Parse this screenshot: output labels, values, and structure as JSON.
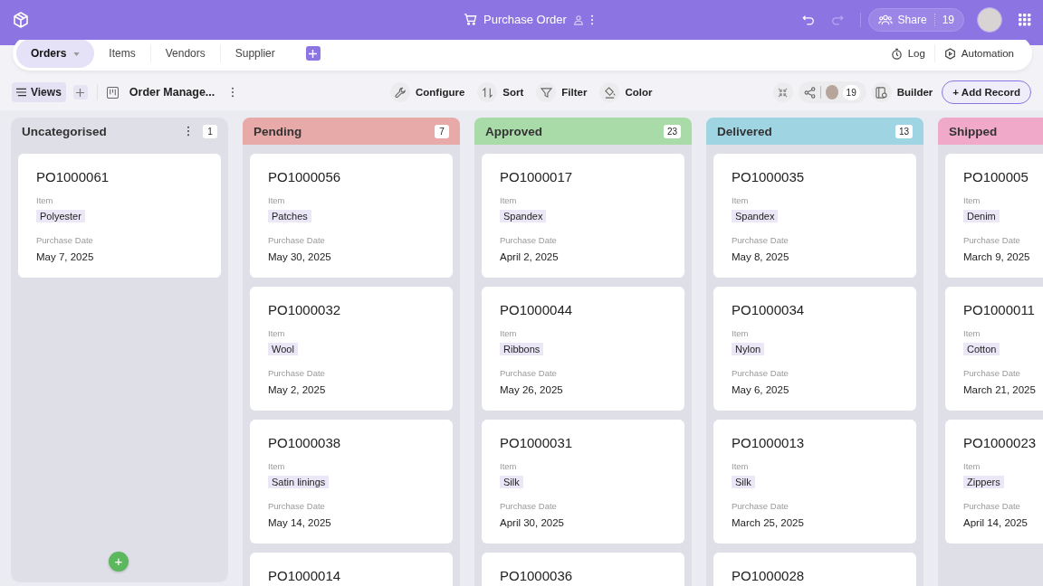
{
  "header": {
    "title": "Purchase Order",
    "share": {
      "label": "Share",
      "count": "19"
    }
  },
  "tabs": [
    {
      "label": "Orders",
      "selected": true
    },
    {
      "label": "Items",
      "selected": false
    },
    {
      "label": "Vendors",
      "selected": false
    },
    {
      "label": "Supplier",
      "selected": false
    }
  ],
  "tab_actions": [
    {
      "kind": "log",
      "label": "Log"
    },
    {
      "kind": "automation",
      "label": "Automation"
    }
  ],
  "toolbar": {
    "views": "Views",
    "view_name": "Order Manage...",
    "tools": [
      {
        "kind": "configure",
        "label": "Configure"
      },
      {
        "kind": "sort",
        "label": "Sort"
      },
      {
        "kind": "filter",
        "label": "Filter"
      },
      {
        "kind": "color",
        "label": "Color"
      }
    ],
    "collaborators": "19",
    "builder": "Builder",
    "add_record": "+ Add Record"
  },
  "columns": [
    {
      "kind": "uncategorised",
      "title": "Uncategorised",
      "count": "1",
      "add": "+",
      "cards": [
        {
          "id": "PO1000061",
          "item_label": "Item",
          "item": "Polyester",
          "date_label": "Purchase Date",
          "date": "May 7, 2025"
        }
      ]
    },
    {
      "kind": "status",
      "title": "Pending",
      "color": "#e8aaa8",
      "count": "7",
      "cards": [
        {
          "id": "PO1000056",
          "item_label": "Item",
          "item": "Patches",
          "date_label": "Purchase Date",
          "date": "May 30, 2025"
        },
        {
          "id": "PO1000032",
          "item_label": "Item",
          "item": "Wool",
          "date_label": "Purchase Date",
          "date": "May 2, 2025"
        },
        {
          "id": "PO1000038",
          "item_label": "Item",
          "item": "Satin linings",
          "date_label": "Purchase Date",
          "date": "May 14, 2025"
        },
        {
          "id": "PO1000014"
        }
      ]
    },
    {
      "kind": "status",
      "title": "Approved",
      "color": "#a9dba9",
      "count": "23",
      "cards": [
        {
          "id": "PO1000017",
          "item_label": "Item",
          "item": "Spandex",
          "date_label": "Purchase Date",
          "date": "April 2, 2025"
        },
        {
          "id": "PO1000044",
          "item_label": "Item",
          "item": "Ribbons",
          "date_label": "Purchase Date",
          "date": "May 26, 2025"
        },
        {
          "id": "PO1000031",
          "item_label": "Item",
          "item": "Silk",
          "date_label": "Purchase Date",
          "date": "April 30, 2025"
        },
        {
          "id": "PO1000036"
        }
      ]
    },
    {
      "kind": "status",
      "title": "Delivered",
      "color": "#9fd5e3",
      "count": "13",
      "cards": [
        {
          "id": "PO1000035",
          "item_label": "Item",
          "item": "Spandex",
          "date_label": "Purchase Date",
          "date": "May 8, 2025"
        },
        {
          "id": "PO1000034",
          "item_label": "Item",
          "item": "Nylon",
          "date_label": "Purchase Date",
          "date": "May 6, 2025"
        },
        {
          "id": "PO1000013",
          "item_label": "Item",
          "item": "Silk",
          "date_label": "Purchase Date",
          "date": "March 25, 2025"
        },
        {
          "id": "PO1000028"
        }
      ]
    },
    {
      "kind": "status",
      "title": "Shipped",
      "color": "#f0a9c9",
      "cards": [
        {
          "id": "PO100005",
          "item_label": "Item",
          "item": "Denim",
          "date_label": "Purchase Date",
          "date": "March 9, 2025"
        },
        {
          "id": "PO1000011",
          "item_label": "Item",
          "item": "Cotton",
          "date_label": "Purchase Date",
          "date": "March 21, 2025"
        },
        {
          "id": "PO1000023",
          "item_label": "Item",
          "item": "Zippers",
          "date_label": "Purchase Date",
          "date": "April 14, 2025"
        }
      ]
    }
  ]
}
